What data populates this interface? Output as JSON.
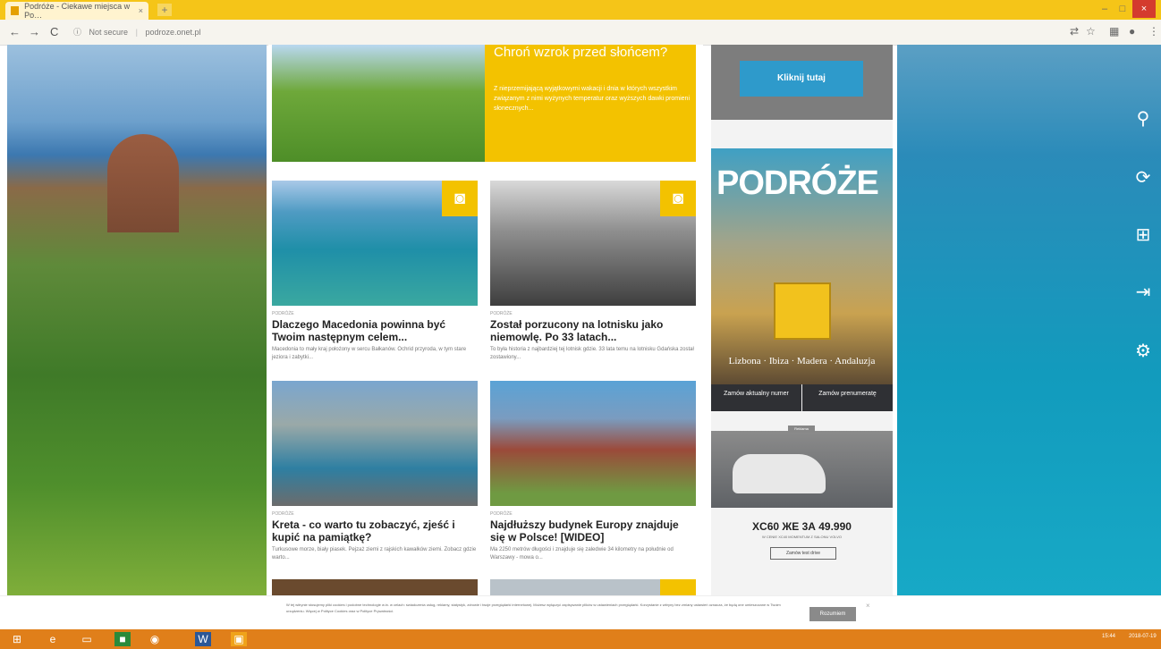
{
  "browser": {
    "tab_title": "Podróże - Ciekawe miejsca w Po…",
    "tab_close": "×",
    "new_tab": "+",
    "win_min": "–",
    "win_max": "□",
    "win_close": "×",
    "nav_back": "←",
    "nav_forward": "→",
    "nav_reload": "C",
    "url_security": "Not secure",
    "url": "podroze.onet.pl"
  },
  "hero": {
    "title": "Chroń wzrok przed słońcem?",
    "text": "Z nieprzemijającą wyjątkowymi wakacji i dnia w których wszystkim związanym z nimi wyżynych temperatur oraz wyższych dawki promieni słonecznych..."
  },
  "cards": [
    {
      "category": "Podróże",
      "title": "Dlaczego Macedonia powinna być Twoim następnym celem...",
      "desc": "Macedonia to mały kraj położony w sercu Bałkanów. Ochrid przyroda, w tym stare jeziora i zabytki..."
    },
    {
      "category": "Podróże",
      "title": "Został porzucony na lotnisku jako niemowlę. Po 33 latach...",
      "desc": "To była historia z najbardziej tej lotnisk gdzie. 33 lata temu na lotnisku Gdańska został zostawiony..."
    },
    {
      "category": "Podróże",
      "title": "Kreta - co warto tu zobaczyć, zjeść i kupić na pamiątkę?",
      "desc": "Turkusowe morze, biały piasek. Pejzaż ziemi z rajskich kawałków ziemi. Zobacz gdzie warto..."
    },
    {
      "category": "Podróże",
      "title": "Najdłuższy budynek Europy znajduje się w Polsce! [WIDEO]",
      "desc": "Ma 2250 metrów długości i znajduje się zaledwie 34 kilometry na południe od Warszawy - mowa o..."
    }
  ],
  "sidebar": {
    "cta_button": "Kliknij tutaj",
    "magazine_logo": "PODRÓŻE",
    "magazine_cities": "Lizbona · Ibiza · Madera · Andaluzja",
    "order_current": "Zamów aktualny numer",
    "order_subscription": "Zamów prenumeratę",
    "ad_label": "Reklama",
    "ad_title": "XC60 ЖЕ 3А 49.990",
    "ad_sub": "W CENIE XC40 MOMENTUM Z SALONU VOLVO",
    "ad_button": "Zamów test drive"
  },
  "consent": {
    "text": "W tej witrynie stosujemy pliki cookies i podobne technologie w.in. w celach: świadczenia usług, reklamy, statystyk, zdrowie i twoje przeglądarki internetowej. Możesz wyłączyć zapisywanie plików w ustawieniach przeglądarki. Korzystanie z witryny bez zmiany ustawień oznacza, że będą one umieszczane w Twoim urządzeniu. Więcej w Polityce Cookies oraz w Polityce Prywatności.",
    "accept": "Rozumiem",
    "close": "×"
  },
  "taskbar": {
    "time": "15:44",
    "date": "2018-07-19"
  }
}
